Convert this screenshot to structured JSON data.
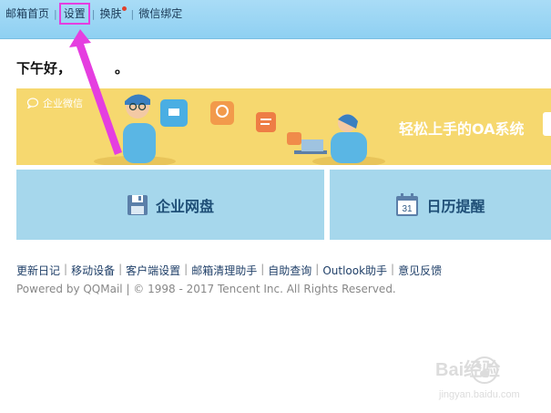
{
  "nav": {
    "items": [
      "邮箱首页",
      "设置",
      "换肤",
      "微信绑定"
    ],
    "separator": "|"
  },
  "greeting": "下午好，",
  "greeting_tail": "。",
  "banner": {
    "logo_text": "企业微信",
    "slogan": "轻松上手的OA系统"
  },
  "tiles": {
    "disk_label": "企业网盘",
    "calendar_label": "日历提醒",
    "calendar_day": "31"
  },
  "footer": {
    "links": [
      "更新日记",
      "移动设备",
      "客户端设置",
      "邮箱清理助手",
      "自助查询",
      "Outlook助手",
      "意见反馈"
    ],
    "separator": "|",
    "copyright": "Powered by QQMail  | © 1998 - 2017 Tencent Inc. All Rights Reserved."
  },
  "watermark": {
    "text": "Bai经验",
    "url": "jingyan.baidu.com"
  },
  "colors": {
    "topbar": "#9fd7f4",
    "highlight": "#e53ee0",
    "banner": "#f6d86f",
    "tile": "#a6d7ec",
    "link": "#1f3f68"
  }
}
